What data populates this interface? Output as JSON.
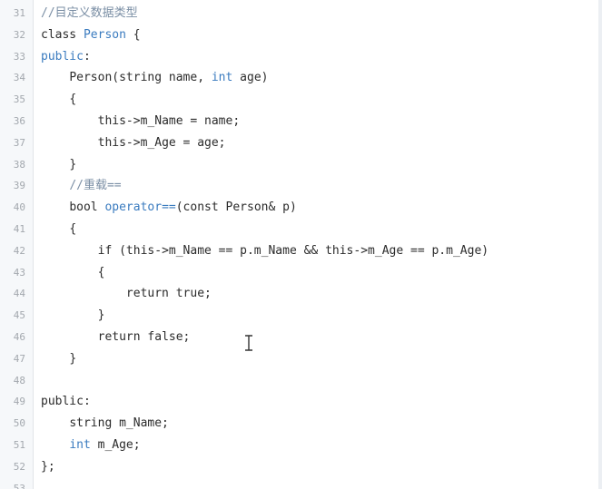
{
  "editor": {
    "lines": [
      {
        "num": "31",
        "indent": "",
        "tokens": [
          {
            "t": "//目定义数据类型",
            "c": "cm"
          }
        ]
      },
      {
        "num": "32",
        "indent": "",
        "tokens": [
          {
            "t": "class ",
            "c": ""
          },
          {
            "t": "Person",
            "c": "cls"
          },
          {
            "t": " {",
            "c": ""
          }
        ]
      },
      {
        "num": "33",
        "indent": "",
        "tokens": [
          {
            "t": "public",
            "c": "kw"
          },
          {
            "t": ":",
            "c": ""
          }
        ]
      },
      {
        "num": "34",
        "indent": "    ",
        "tokens": [
          {
            "t": "Person(string name, ",
            "c": ""
          },
          {
            "t": "int",
            "c": "ty"
          },
          {
            "t": " age)",
            "c": ""
          }
        ]
      },
      {
        "num": "35",
        "indent": "    ",
        "tokens": [
          {
            "t": "{",
            "c": ""
          }
        ]
      },
      {
        "num": "36",
        "indent": "        ",
        "tokens": [
          {
            "t": "this->m_Name = name;",
            "c": ""
          }
        ]
      },
      {
        "num": "37",
        "indent": "        ",
        "tokens": [
          {
            "t": "this->m_Age = age;",
            "c": ""
          }
        ]
      },
      {
        "num": "38",
        "indent": "    ",
        "tokens": [
          {
            "t": "}",
            "c": ""
          }
        ]
      },
      {
        "num": "39",
        "indent": "    ",
        "tokens": [
          {
            "t": "//重载==",
            "c": "cm"
          }
        ]
      },
      {
        "num": "40",
        "indent": "    ",
        "tokens": [
          {
            "t": "bool ",
            "c": ""
          },
          {
            "t": "operator==",
            "c": "op"
          },
          {
            "t": "(const Person& p)",
            "c": ""
          }
        ]
      },
      {
        "num": "41",
        "indent": "    ",
        "tokens": [
          {
            "t": "{",
            "c": ""
          }
        ]
      },
      {
        "num": "42",
        "indent": "        ",
        "tokens": [
          {
            "t": "if (this->m_Name == p.m_Name && this->m_Age == p.m_Age)",
            "c": ""
          }
        ]
      },
      {
        "num": "43",
        "indent": "        ",
        "tokens": [
          {
            "t": "{",
            "c": ""
          }
        ]
      },
      {
        "num": "44",
        "indent": "            ",
        "tokens": [
          {
            "t": "return true;",
            "c": ""
          }
        ]
      },
      {
        "num": "45",
        "indent": "        ",
        "tokens": [
          {
            "t": "}",
            "c": ""
          }
        ]
      },
      {
        "num": "46",
        "indent": "        ",
        "tokens": [
          {
            "t": "return false;",
            "c": ""
          }
        ]
      },
      {
        "num": "47",
        "indent": "    ",
        "tokens": [
          {
            "t": "}",
            "c": ""
          }
        ]
      },
      {
        "num": "48",
        "indent": "",
        "tokens": []
      },
      {
        "num": "49",
        "indent": "",
        "tokens": [
          {
            "t": "public:",
            "c": ""
          }
        ]
      },
      {
        "num": "50",
        "indent": "    ",
        "tokens": [
          {
            "t": "string m_Name;",
            "c": ""
          }
        ]
      },
      {
        "num": "51",
        "indent": "    ",
        "tokens": [
          {
            "t": "int",
            "c": "ty"
          },
          {
            "t": " m_Age;",
            "c": ""
          }
        ]
      },
      {
        "num": "52",
        "indent": "",
        "tokens": [
          {
            "t": "};",
            "c": ""
          }
        ]
      },
      {
        "num": "53",
        "indent": "",
        "tokens": []
      }
    ]
  },
  "cursor": {
    "icon": "text-cursor-icon"
  },
  "colors": {
    "keyword": "#3a7bbf",
    "comment": "#7b8fa5",
    "text": "#2b2b2b",
    "line_number": "#a3a8ae",
    "gutter_bg": "#f6f8fa"
  }
}
